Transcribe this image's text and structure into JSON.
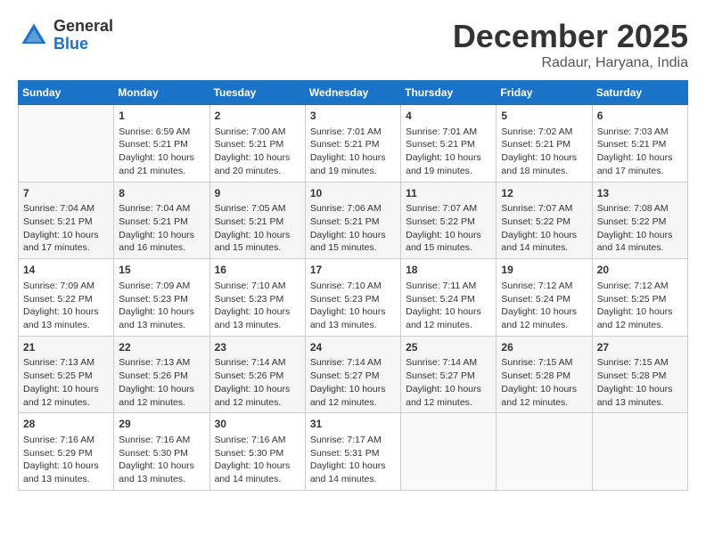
{
  "header": {
    "logo_general": "General",
    "logo_blue": "Blue",
    "month": "December 2025",
    "location": "Radaur, Haryana, India"
  },
  "days_of_week": [
    "Sunday",
    "Monday",
    "Tuesday",
    "Wednesday",
    "Thursday",
    "Friday",
    "Saturday"
  ],
  "weeks": [
    [
      {
        "day": "",
        "info": ""
      },
      {
        "day": "1",
        "info": "Sunrise: 6:59 AM\nSunset: 5:21 PM\nDaylight: 10 hours\nand 21 minutes."
      },
      {
        "day": "2",
        "info": "Sunrise: 7:00 AM\nSunset: 5:21 PM\nDaylight: 10 hours\nand 20 minutes."
      },
      {
        "day": "3",
        "info": "Sunrise: 7:01 AM\nSunset: 5:21 PM\nDaylight: 10 hours\nand 19 minutes."
      },
      {
        "day": "4",
        "info": "Sunrise: 7:01 AM\nSunset: 5:21 PM\nDaylight: 10 hours\nand 19 minutes."
      },
      {
        "day": "5",
        "info": "Sunrise: 7:02 AM\nSunset: 5:21 PM\nDaylight: 10 hours\nand 18 minutes."
      },
      {
        "day": "6",
        "info": "Sunrise: 7:03 AM\nSunset: 5:21 PM\nDaylight: 10 hours\nand 17 minutes."
      }
    ],
    [
      {
        "day": "7",
        "info": "Sunrise: 7:04 AM\nSunset: 5:21 PM\nDaylight: 10 hours\nand 17 minutes."
      },
      {
        "day": "8",
        "info": "Sunrise: 7:04 AM\nSunset: 5:21 PM\nDaylight: 10 hours\nand 16 minutes."
      },
      {
        "day": "9",
        "info": "Sunrise: 7:05 AM\nSunset: 5:21 PM\nDaylight: 10 hours\nand 15 minutes."
      },
      {
        "day": "10",
        "info": "Sunrise: 7:06 AM\nSunset: 5:21 PM\nDaylight: 10 hours\nand 15 minutes."
      },
      {
        "day": "11",
        "info": "Sunrise: 7:07 AM\nSunset: 5:22 PM\nDaylight: 10 hours\nand 15 minutes."
      },
      {
        "day": "12",
        "info": "Sunrise: 7:07 AM\nSunset: 5:22 PM\nDaylight: 10 hours\nand 14 minutes."
      },
      {
        "day": "13",
        "info": "Sunrise: 7:08 AM\nSunset: 5:22 PM\nDaylight: 10 hours\nand 14 minutes."
      }
    ],
    [
      {
        "day": "14",
        "info": "Sunrise: 7:09 AM\nSunset: 5:22 PM\nDaylight: 10 hours\nand 13 minutes."
      },
      {
        "day": "15",
        "info": "Sunrise: 7:09 AM\nSunset: 5:23 PM\nDaylight: 10 hours\nand 13 minutes."
      },
      {
        "day": "16",
        "info": "Sunrise: 7:10 AM\nSunset: 5:23 PM\nDaylight: 10 hours\nand 13 minutes."
      },
      {
        "day": "17",
        "info": "Sunrise: 7:10 AM\nSunset: 5:23 PM\nDaylight: 10 hours\nand 13 minutes."
      },
      {
        "day": "18",
        "info": "Sunrise: 7:11 AM\nSunset: 5:24 PM\nDaylight: 10 hours\nand 12 minutes."
      },
      {
        "day": "19",
        "info": "Sunrise: 7:12 AM\nSunset: 5:24 PM\nDaylight: 10 hours\nand 12 minutes."
      },
      {
        "day": "20",
        "info": "Sunrise: 7:12 AM\nSunset: 5:25 PM\nDaylight: 10 hours\nand 12 minutes."
      }
    ],
    [
      {
        "day": "21",
        "info": "Sunrise: 7:13 AM\nSunset: 5:25 PM\nDaylight: 10 hours\nand 12 minutes."
      },
      {
        "day": "22",
        "info": "Sunrise: 7:13 AM\nSunset: 5:26 PM\nDaylight: 10 hours\nand 12 minutes."
      },
      {
        "day": "23",
        "info": "Sunrise: 7:14 AM\nSunset: 5:26 PM\nDaylight: 10 hours\nand 12 minutes."
      },
      {
        "day": "24",
        "info": "Sunrise: 7:14 AM\nSunset: 5:27 PM\nDaylight: 10 hours\nand 12 minutes."
      },
      {
        "day": "25",
        "info": "Sunrise: 7:14 AM\nSunset: 5:27 PM\nDaylight: 10 hours\nand 12 minutes."
      },
      {
        "day": "26",
        "info": "Sunrise: 7:15 AM\nSunset: 5:28 PM\nDaylight: 10 hours\nand 12 minutes."
      },
      {
        "day": "27",
        "info": "Sunrise: 7:15 AM\nSunset: 5:28 PM\nDaylight: 10 hours\nand 13 minutes."
      }
    ],
    [
      {
        "day": "28",
        "info": "Sunrise: 7:16 AM\nSunset: 5:29 PM\nDaylight: 10 hours\nand 13 minutes."
      },
      {
        "day": "29",
        "info": "Sunrise: 7:16 AM\nSunset: 5:30 PM\nDaylight: 10 hours\nand 13 minutes."
      },
      {
        "day": "30",
        "info": "Sunrise: 7:16 AM\nSunset: 5:30 PM\nDaylight: 10 hours\nand 14 minutes."
      },
      {
        "day": "31",
        "info": "Sunrise: 7:17 AM\nSunset: 5:31 PM\nDaylight: 10 hours\nand 14 minutes."
      },
      {
        "day": "",
        "info": ""
      },
      {
        "day": "",
        "info": ""
      },
      {
        "day": "",
        "info": ""
      }
    ]
  ]
}
